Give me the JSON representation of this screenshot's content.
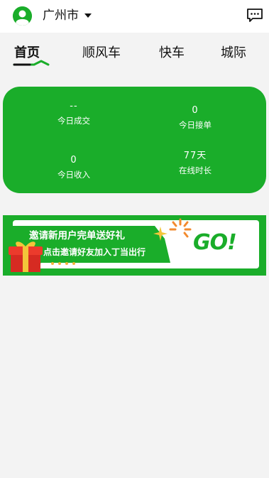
{
  "header": {
    "city": "广州市",
    "avatar_icon": "user-icon",
    "message_icon": "message-icon"
  },
  "tabs": [
    {
      "label": "首页",
      "active": true
    },
    {
      "label": "顺风车",
      "active": false
    },
    {
      "label": "快车",
      "active": false
    },
    {
      "label": "城际",
      "active": false
    }
  ],
  "stats": {
    "today_deals": {
      "value": "--",
      "label": "今日成交"
    },
    "today_orders": {
      "value": "0",
      "label": "今日接单"
    },
    "today_income": {
      "value": "0",
      "label": "今日收入"
    },
    "online_time": {
      "value": "77天",
      "label": "在线时长"
    }
  },
  "banner": {
    "line1": "邀请新用户完单送好礼",
    "line2": "点击邀请好友加入丁当出行",
    "go": "GO!"
  },
  "colors": {
    "brand_green": "#1aad2a",
    "background": "#f3f3f3",
    "accent_gold": "#f6b33a"
  }
}
